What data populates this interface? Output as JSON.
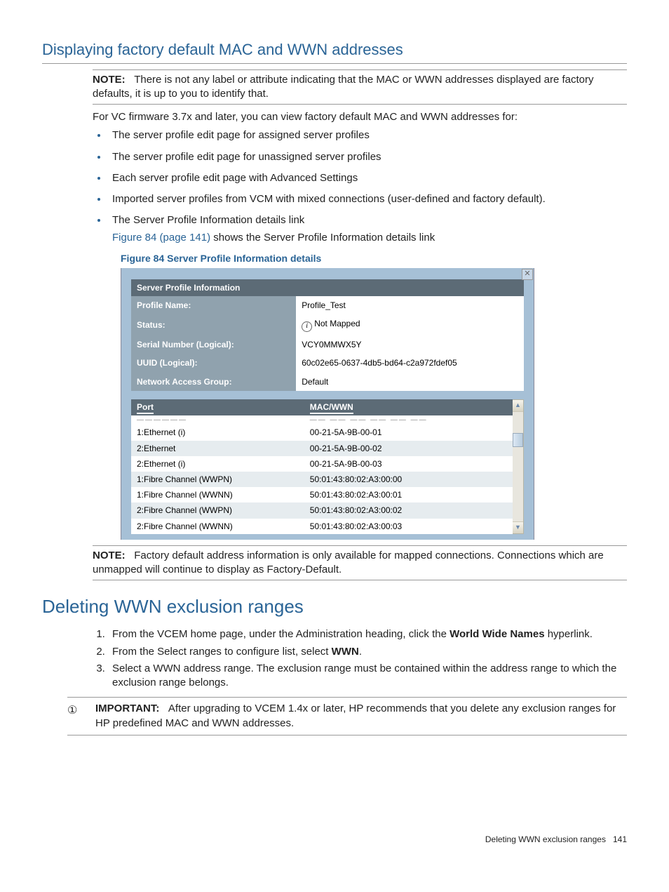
{
  "section1": {
    "heading": "Displaying factory default MAC and WWN addresses",
    "note_label": "NOTE:",
    "note_text": "There is not any label or attribute indicating that the MAC or WWN addresses displayed are factory defaults, it is up to you to identify that.",
    "intro": "For VC firmware 3.7x and later, you can view factory default MAC and WWN addresses for:",
    "bullets": [
      "The server profile edit page for assigned server profiles",
      "The server profile edit page for unassigned server profiles",
      "Each server profile edit page with Advanced Settings",
      "Imported server profiles from VCM with mixed connections (user-defined and factory default).",
      "The Server Profile Information details link"
    ],
    "bullet5_link": "Figure 84 (page 141)",
    "bullet5_rest": " shows the Server Profile Information details link",
    "fig_caption": "Figure 84 Server Profile Information details"
  },
  "panel": {
    "header": "Server Profile Information",
    "rows": [
      {
        "label": "Profile Name:",
        "value": "Profile_Test"
      },
      {
        "label": "Status:",
        "value": "Not Mapped",
        "icon": true
      },
      {
        "label": "Serial Number (Logical):",
        "value": "VCY0MMWX5Y"
      },
      {
        "label": "UUID (Logical):",
        "value": "60c02e65-0637-4db5-bd64-c2a972fdef05"
      },
      {
        "label": "Network Access Group:",
        "value": "Default"
      }
    ],
    "port_header": "Port",
    "mac_header": "MAC/WWN",
    "ports": [
      {
        "port": "1:Ethernet (i)",
        "mac": "00-21-5A-9B-00-01"
      },
      {
        "port": "2:Ethernet",
        "mac": "00-21-5A-9B-00-02"
      },
      {
        "port": "2:Ethernet (i)",
        "mac": "00-21-5A-9B-00-03"
      },
      {
        "port": "1:Fibre Channel (WWPN)",
        "mac": "50:01:43:80:02:A3:00:00"
      },
      {
        "port": "1:Fibre Channel (WWNN)",
        "mac": "50:01:43:80:02:A3:00:01"
      },
      {
        "port": "2:Fibre Channel (WWPN)",
        "mac": "50:01:43:80:02:A3:00:02"
      },
      {
        "port": "2:Fibre Channel (WWNN)",
        "mac": "50:01:43:80:02:A3:00:03"
      }
    ]
  },
  "note2": {
    "label": "NOTE:",
    "text": "Factory default address information is only available for mapped connections. Connections which are unmapped will continue to display as Factory-Default."
  },
  "section2": {
    "heading": "Deleting WWN exclusion ranges",
    "steps": [
      {
        "pre": "From the VCEM home page, under the Administration heading, click the ",
        "bold": "World Wide Names",
        "post": " hyperlink."
      },
      {
        "pre": "From the Select ranges to configure list, select ",
        "bold": "WWN",
        "post": "."
      },
      {
        "pre": "Select a WWN address range. The exclusion range must be contained within the address range to which the exclusion range belongs.",
        "bold": "",
        "post": ""
      }
    ],
    "important_label": "IMPORTANT:",
    "important_text": "After upgrading to VCEM 1.4x or later, HP recommends that you delete any exclusion ranges for HP predefined MAC and WWN addresses."
  },
  "footer": {
    "title": "Deleting WWN exclusion ranges",
    "page": "141"
  }
}
